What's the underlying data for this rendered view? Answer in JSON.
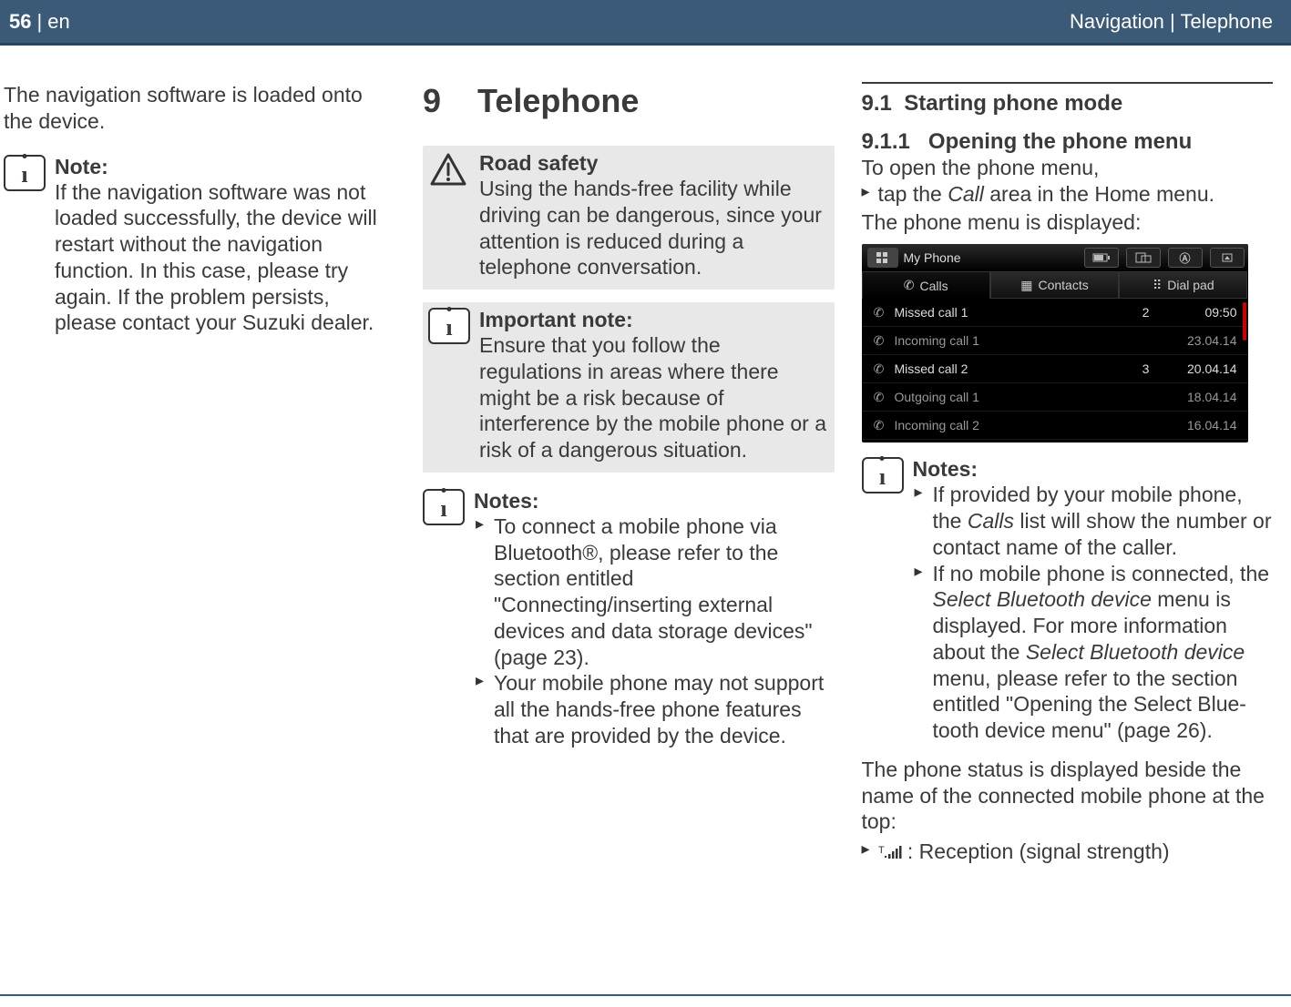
{
  "header": {
    "page_number": "56",
    "lang": "en",
    "breadcrumb": "Navigation | Telephone"
  },
  "col_left": {
    "intro": "The navigation software is loaded onto the device.",
    "note": {
      "title": "Note:",
      "body": "If the navigation software was not loaded successfully, the device will restart without the navigation function. In this case, please try again. If the problem persists, please contact your Suzuki dealer."
    }
  },
  "col_mid": {
    "chapter_num": "9",
    "chapter_title": "Telephone",
    "road_safety": {
      "title": "Road safety",
      "body": "Using the hands-free facility while driving can be dangerous, since your attention is reduced during a telephone conversation."
    },
    "important_note": {
      "title": "Important note:",
      "body": "Ensure that you follow the regulations in areas where there might be a risk because of interference by the mobile phone or a risk of a dangerous situation."
    },
    "notes": {
      "title": "Notes:",
      "items": [
        "To connect a mobile phone via Bluetooth®, please refer to the section entitled \"Connecting/inserting external devices and data storage devices\" (page 23).",
        "Your mobile phone may not support all the hands-free phone features that are provided by the device."
      ]
    }
  },
  "col_right": {
    "section_num": "9.1",
    "section_title": "Starting phone mode",
    "sub_num": "9.1.1",
    "sub_title": "Opening the phone menu",
    "open_line": "To open the phone menu,",
    "tap_prefix": "tap the ",
    "tap_ital": "Call",
    "tap_suffix": " area in the Home menu.",
    "displayed_line": "The phone menu is displayed:",
    "phone_ui": {
      "title": "My Phone",
      "tabs": {
        "calls": "Calls",
        "contacts": "Contacts",
        "dialpad": "Dial pad"
      },
      "rows": [
        {
          "label": "Missed call 1",
          "count": "2",
          "time": "09:50",
          "dim": false
        },
        {
          "label": "Incoming call 1",
          "count": "",
          "time": "23.04.14",
          "dim": true
        },
        {
          "label": "Missed call 2",
          "count": "3",
          "time": "20.04.14",
          "dim": false
        },
        {
          "label": "Outgoing call 1",
          "count": "",
          "time": "18.04.14",
          "dim": true
        },
        {
          "label": "Incoming call 2",
          "count": "",
          "time": "16.04.14",
          "dim": true
        }
      ]
    },
    "notes2": {
      "title": "Notes:",
      "item1_prefix": "If provided by your mobile phone, the ",
      "item1_ital": "Calls",
      "item1_suffix": " list will show the number or contact name of the caller.",
      "item2_prefix": "If no mobile phone is connected, the ",
      "item2_ital1": "Select Bluetooth device",
      "item2_mid": " menu is displayed. For more information about the ",
      "item2_ital2": "Select Bluetooth device",
      "item2_suffix": " menu, please refer to the section entitled \"Opening the Select Blue­tooth device menu\" (page 26)."
    },
    "status_line": "The phone status is displayed beside the name of the connected mobile phone at the top:",
    "reception_label": " : Reception (signal strength)"
  }
}
